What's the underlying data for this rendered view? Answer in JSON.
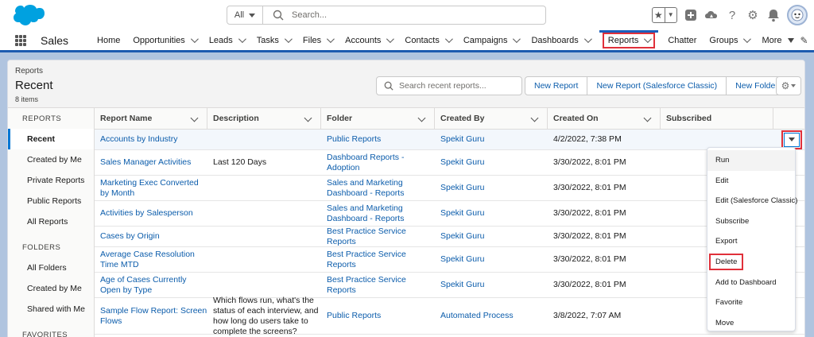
{
  "global_header": {
    "search_scope": "All",
    "search_placeholder": "Search...",
    "icons": [
      "favorites-star-icon",
      "add-icon",
      "trailhead-icon",
      "help-icon",
      "setup-gear-icon",
      "notifications-bell-icon",
      "user-avatar"
    ]
  },
  "nav": {
    "app_name": "Sales",
    "items": [
      {
        "label": "Home",
        "dropdown": false
      },
      {
        "label": "Opportunities",
        "dropdown": true
      },
      {
        "label": "Leads",
        "dropdown": true
      },
      {
        "label": "Tasks",
        "dropdown": true
      },
      {
        "label": "Files",
        "dropdown": true
      },
      {
        "label": "Accounts",
        "dropdown": true
      },
      {
        "label": "Contacts",
        "dropdown": true
      },
      {
        "label": "Campaigns",
        "dropdown": true
      },
      {
        "label": "Dashboards",
        "dropdown": true
      },
      {
        "label": "Reports",
        "dropdown": true,
        "active": true
      },
      {
        "label": "Chatter",
        "dropdown": false
      },
      {
        "label": "Groups",
        "dropdown": true
      },
      {
        "label": "More",
        "dropdown": true
      }
    ]
  },
  "list_header": {
    "object": "Reports",
    "title": "Recent",
    "count": "8 items",
    "search_placeholder": "Search recent reports...",
    "buttons": [
      "New Report",
      "New Report (Salesforce Classic)",
      "New Folder"
    ]
  },
  "sidebar": {
    "reports_section": "REPORTS",
    "reports_items": [
      "Recent",
      "Created by Me",
      "Private Reports",
      "Public Reports",
      "All Reports"
    ],
    "folders_section": "FOLDERS",
    "folders_items": [
      "All Folders",
      "Created by Me",
      "Shared with Me"
    ],
    "favorites_section": "FAVORITES"
  },
  "table": {
    "columns": [
      "Report Name",
      "Description",
      "Folder",
      "Created By",
      "Created On",
      "Subscribed"
    ],
    "rows": [
      {
        "name": "Accounts by Industry",
        "description": "",
        "folder": "Public Reports",
        "created_by": "Spekit Guru",
        "created_on": "4/2/2022, 7:38 PM"
      },
      {
        "name": "Sales Manager Activities",
        "description": "Last 120 Days",
        "folder": "Dashboard Reports - Adoption",
        "created_by": "Spekit Guru",
        "created_on": "3/30/2022, 8:01 PM"
      },
      {
        "name": "Marketing Exec Converted by Month",
        "description": "",
        "folder": "Sales and Marketing Dashboard - Reports",
        "created_by": "Spekit Guru",
        "created_on": "3/30/2022, 8:01 PM"
      },
      {
        "name": "Activities by Salesperson",
        "description": "",
        "folder": "Sales and Marketing Dashboard - Reports",
        "created_by": "Spekit Guru",
        "created_on": "3/30/2022, 8:01 PM"
      },
      {
        "name": "Cases by Origin",
        "description": "",
        "folder": "Best Practice Service Reports",
        "created_by": "Spekit Guru",
        "created_on": "3/30/2022, 8:01 PM"
      },
      {
        "name": "Average Case Resolution Time MTD",
        "description": "",
        "folder": "Best Practice Service Reports",
        "created_by": "Spekit Guru",
        "created_on": "3/30/2022, 8:01 PM"
      },
      {
        "name": "Age of Cases Currently Open by Type",
        "description": "",
        "folder": "Best Practice Service Reports",
        "created_by": "Spekit Guru",
        "created_on": "3/30/2022, 8:01 PM"
      },
      {
        "name": "Sample Flow Report: Screen Flows",
        "description": "Which flows run, what's the status of each interview, and how long do users take to complete the screens?",
        "folder": "Public Reports",
        "created_by": "Automated Process",
        "created_on": "3/8/2022, 7:07 AM"
      }
    ]
  },
  "row_menu": {
    "items": [
      "Run",
      "Edit",
      "Edit (Salesforce Classic)",
      "Subscribe",
      "Export",
      "Delete",
      "Add to Dashboard",
      "Favorite",
      "Move"
    ]
  },
  "colors": {
    "brand_blue": "#0176d3",
    "link_blue": "#0b5cab",
    "highlight_red": "#e0303a",
    "logo_blue": "#00a1e0"
  }
}
